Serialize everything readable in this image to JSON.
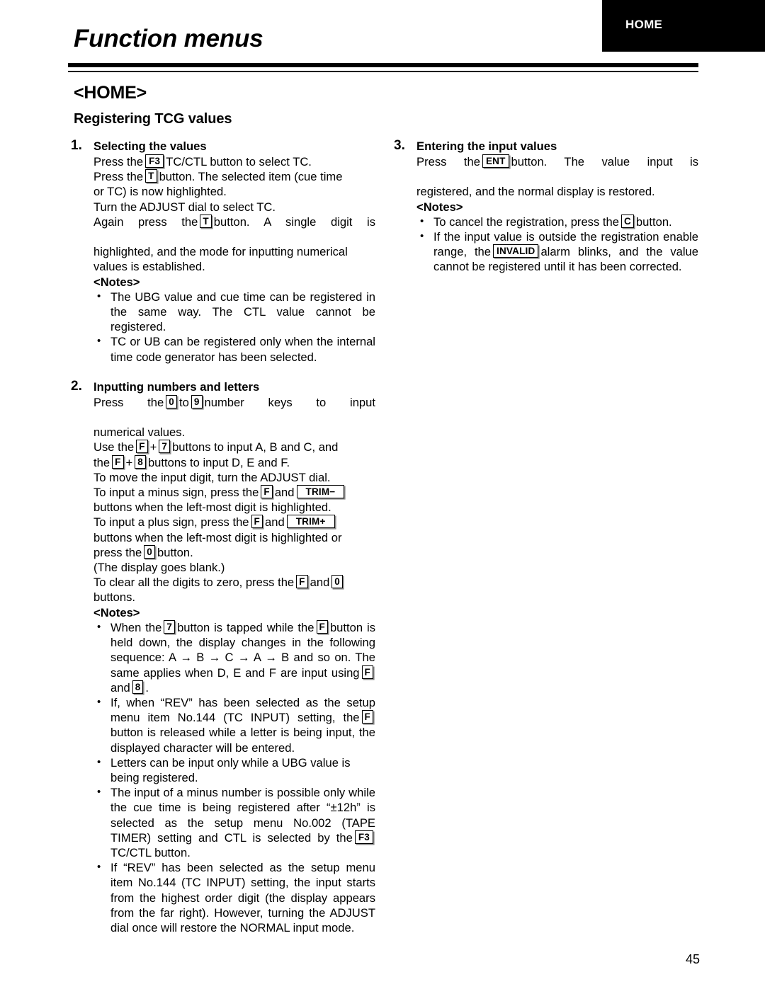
{
  "header": {
    "title": "Function menus",
    "tab_label": "HOME"
  },
  "section": {
    "title": "<HOME>",
    "subtitle": "Registering TCG values"
  },
  "keys": {
    "f3": "F3",
    "t": "T",
    "f": "F",
    "c": "C",
    "zero": "0",
    "nine": "9",
    "seven": "7",
    "eight": "8",
    "ent": "ENT",
    "trim_minus": "TRIM−",
    "trim_plus": "TRIM+",
    "invalid": "INVALID"
  },
  "labels": {
    "notes": "<Notes>",
    "bullet": "•"
  },
  "steps": {
    "step1": {
      "number": "1.",
      "heading": "Selecting the values",
      "line1_a": "Press the",
      "line1_b": "TC/CTL button to select TC.",
      "line2_a": "Press the",
      "line2_b": "button.  The selected item (cue time",
      "line3": "or TC) is now highlighted.",
      "line4": "Turn the ADJUST dial to select TC.",
      "line5_a": "Again press the",
      "line5_b": "button.  A single digit is",
      "line6": "highlighted, and the mode for inputting numerical",
      "line7": "values is established.",
      "notes": [
        "The UBG value and cue time can be registered in the same way.  The CTL value cannot be registered.",
        "TC or UB can be registered only when the internal time code generator has been selected."
      ]
    },
    "step2": {
      "number": "2.",
      "heading": "Inputting numbers and letters",
      "line1_a": "Press the",
      "line1_b": "to",
      "line1_c": "number keys to input",
      "line2": "numerical values.",
      "line3_a": "Use the",
      "line3_b": "+",
      "line3_c": "buttons to input A, B and C, and",
      "line4_a": "the",
      "line4_b": "+",
      "line4_c": "buttons to input D, E and F.",
      "line5": "To move the input digit, turn the ADJUST dial.",
      "line6_a": "To input a minus sign, press the",
      "line6_b": "and",
      "line7": "buttons when the left-most digit is highlighted.",
      "line8_a": "To input a plus sign, press the",
      "line8_b": "and",
      "line9": "buttons when the left-most digit is highlighted or",
      "line10_a": "press the",
      "line10_b": "button.",
      "line11": "(The display goes blank.)",
      "line12_a": "To clear all the digits to zero, press the",
      "line12_b": "and",
      "line13": "buttons.",
      "note1": {
        "a": "When the",
        "b": "button is tapped while the",
        "c": "button is held down, the display changes in the following sequence: A → B → C → A → B and so on.  The same applies when D, E and F are input using",
        "d": "and",
        "e": "."
      },
      "note2": {
        "a": "If, when “REV” has been selected as the setup menu item No.144 (TC INPUT) setting, the",
        "b": "button is released while a letter is being input, the displayed character will be entered."
      },
      "note3": "Letters can be input only while a UBG value is being registered.",
      "note4": {
        "a": "The input of a minus number is possible only while the cue time is being registered after “±12h” is selected as the setup menu No.002 (TAPE TIMER) setting and CTL is selected by the",
        "b": "TC/CTL button."
      },
      "note5": "If “REV” has been selected as the setup menu item No.144 (TC INPUT) setting, the input starts from the highest order digit (the display appears from the far right).  However, turning the ADJUST dial once will restore the NORMAL input mode."
    },
    "step3": {
      "number": "3.",
      "heading": "Entering the input values",
      "line1_a": "Press the",
      "line1_b": "button.  The value input is",
      "line2": "registered, and the normal display is restored.",
      "note1": {
        "a": "To cancel the registration, press the",
        "b": "button."
      },
      "note2": {
        "a": "If the input value is outside the registration enable range, the",
        "b": "alarm blinks, and the value cannot be registered until it has been corrected."
      }
    }
  },
  "footer": {
    "page_number": "45"
  }
}
